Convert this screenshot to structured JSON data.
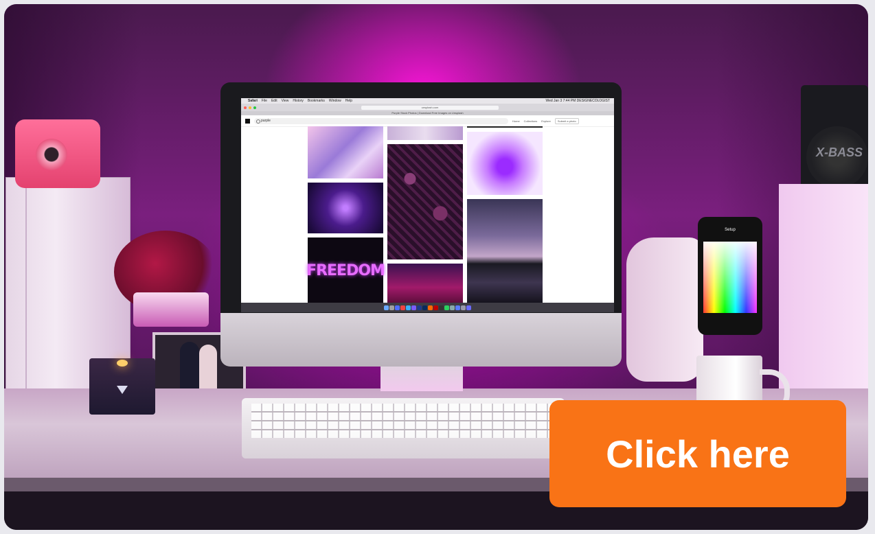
{
  "scene": {
    "speaker_text": "X-BASS",
    "freedom_sign": "FREEDOM",
    "phone_title": "Setup"
  },
  "screen": {
    "menubar_app": "Safari",
    "menubar_items": [
      "File",
      "Edit",
      "View",
      "History",
      "Bookmarks",
      "Window",
      "Help"
    ],
    "menubar_right": "Wed Jan 3  7:44 PM  DESIGNECOLOGIST",
    "address": "unsplash.com",
    "tab_title": "Purple Stock Photos | Download Free Images on Unsplash",
    "search_value": "purple",
    "nav_items": [
      "Home",
      "Collections",
      "Explore"
    ],
    "submit_label": "Submit a photo"
  },
  "cta": {
    "label": "Click here",
    "color": "#f97316"
  }
}
